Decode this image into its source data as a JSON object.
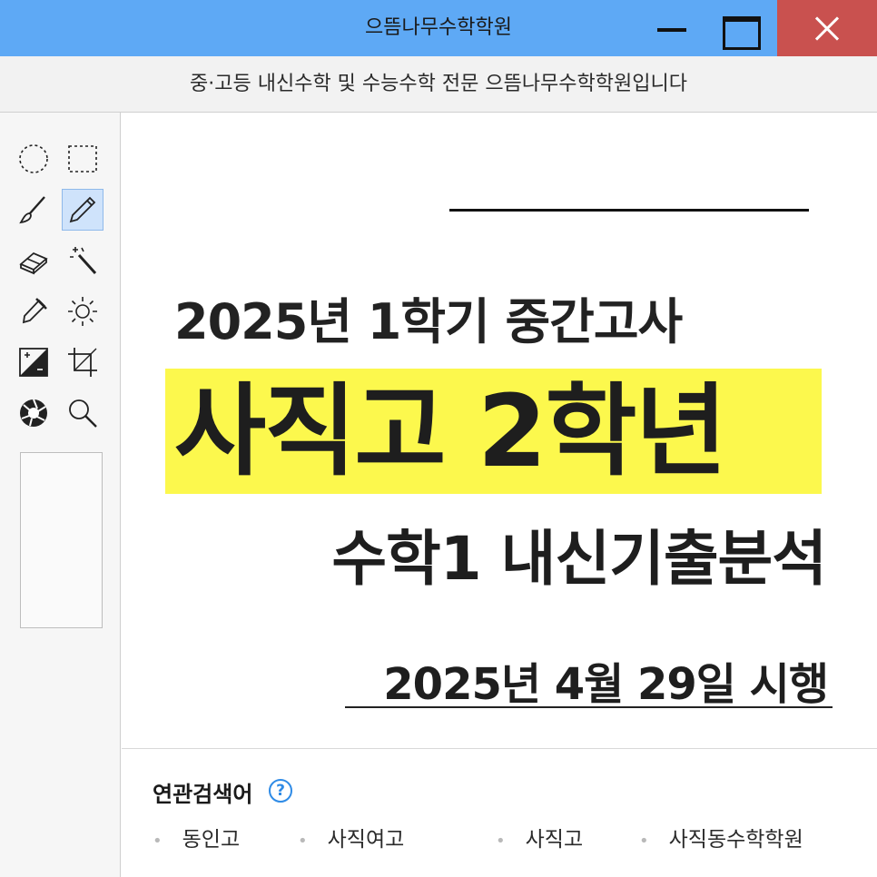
{
  "window": {
    "title": "으뜸나무수학학원"
  },
  "banner": {
    "text": "중·고등 내신수학 및 수능수학 전문 으뜸나무수학학원입니다"
  },
  "toolbar": {
    "tools": [
      {
        "name": "ellipse-select"
      },
      {
        "name": "rect-select"
      },
      {
        "name": "brush"
      },
      {
        "name": "pencil",
        "active": true
      },
      {
        "name": "eraser"
      },
      {
        "name": "magic-wand"
      },
      {
        "name": "eyedropper"
      },
      {
        "name": "brightness"
      },
      {
        "name": "exposure"
      },
      {
        "name": "crop"
      },
      {
        "name": "aperture"
      },
      {
        "name": "zoom"
      }
    ]
  },
  "poster": {
    "line1": "2025년 1학기 중간고사",
    "line2": "사직고 2학년",
    "line3": "수학1 내신기출분석",
    "line4": "2025년 4월 29일 시행",
    "highlight_color": "#fcf84d"
  },
  "related": {
    "title": "연관검색어",
    "help": "?",
    "keywords": [
      "동인고",
      "사직여고",
      "사직고",
      "사직동수학학원"
    ]
  }
}
